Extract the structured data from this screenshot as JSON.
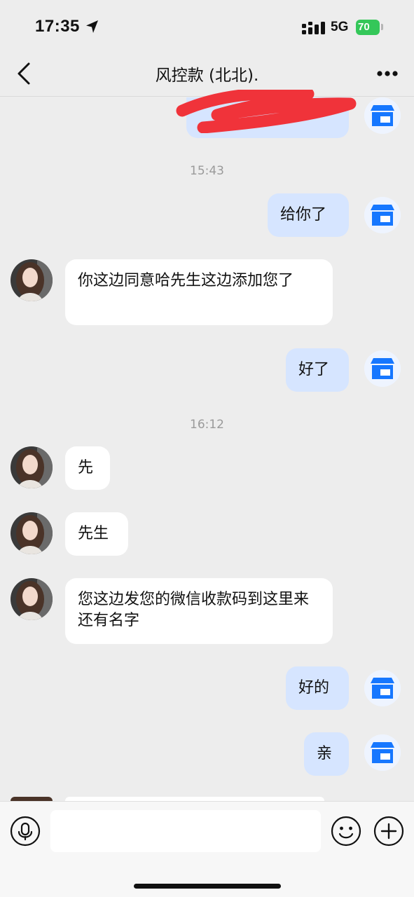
{
  "status_bar": {
    "time": "17:35",
    "network": "5G",
    "battery": "70"
  },
  "chat": {
    "title": "风控款 (北北)."
  },
  "messages": {
    "time_1": "15:43",
    "out_1": "给你了",
    "in_1": "你这边同意哈先生这边添加您了",
    "out_2": "好了",
    "time_2": "16:12",
    "in_2": "先",
    "in_3": "先生",
    "in_4": "您这边发您的微信收款码到这里来还有名字",
    "out_3": "好的",
    "out_4": "亲"
  },
  "input": {
    "placeholder": ""
  },
  "colors": {
    "outgoing_bubble": "#D6E5FF",
    "incoming_bubble": "#FFFFFF",
    "background": "#EDEDED",
    "battery": "#34C759",
    "redaction": "#F0333A",
    "shop_icon": "#1677FF"
  }
}
